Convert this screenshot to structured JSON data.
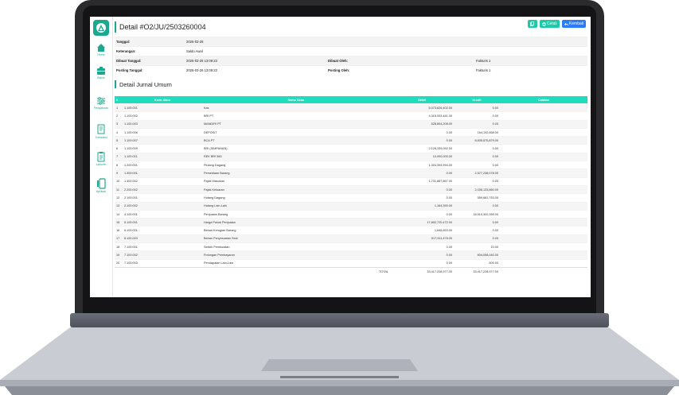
{
  "header": {
    "title": "Detail #O2/JU/2503260004",
    "buttons": {
      "copy": "",
      "print": "Cetak",
      "back": "Kembali"
    }
  },
  "sidebar": {
    "items": [
      {
        "label": "Home",
        "icon": "home-icon"
      },
      {
        "label": "Bisnis",
        "icon": "briefcase-icon"
      },
      {
        "label": "Pengaturan",
        "icon": "sliders-icon"
      },
      {
        "label": "Transaksi",
        "icon": "document-icon"
      },
      {
        "label": "Laporan",
        "icon": "clipboard-icon"
      },
      {
        "label": "Aplikasi",
        "icon": "apps-icon"
      }
    ]
  },
  "info": {
    "tanggal_label": "Tanggal:",
    "tanggal": "2025-03-26",
    "keterangan_label": "Keterangan:",
    "keterangan": "Saldo Awal",
    "dibuat_tanggal_label": "Dibuat Tanggal:",
    "dibuat_tanggal": "2025-03-26 13:09:23",
    "dibuat_oleh_label": "Dibuat Oleh:",
    "dibuat_oleh": "Fakturis 1",
    "posting_tanggal_label": "Posting Tanggal:",
    "posting_tanggal": "2025-03-26 13:09:23",
    "posting_oleh_label": "Posting Oleh:",
    "posting_oleh": "Fakturis 1"
  },
  "section_title": "Detail Jurnal Umum",
  "table": {
    "headers": [
      "#",
      "Kode Akun",
      "Nama Akun",
      "Debit",
      "Kredit",
      "Catatan"
    ],
    "rows": [
      [
        "1",
        "1.100.001",
        "Kas",
        "5,073,626,402.00",
        "0.00",
        ""
      ],
      [
        "2",
        "1.100.002",
        "BRI PT",
        "4,315,333,461.00",
        "0.00",
        ""
      ],
      [
        "3",
        "1.100.003",
        "MANDIRI PT",
        "528,804,208.00",
        "0.00",
        ""
      ],
      [
        "4",
        "1.100.006",
        "DEPOSIT",
        "0.00",
        "164,192,668.00",
        ""
      ],
      [
        "5",
        "1.100.007",
        "BCA PT",
        "0.00",
        "8,835,575,879.00",
        ""
      ],
      [
        "6",
        "1.100.009",
        "BRI (SIMPANAN)",
        "2,128,339,052.00",
        "0.00",
        ""
      ],
      [
        "7",
        "1.100.011",
        "REK BRI 560",
        "10,000,000.00",
        "0.00",
        ""
      ],
      [
        "8",
        "1.200.001",
        "Piutang Dagang",
        "1,304,394,994.00",
        "0.00",
        ""
      ],
      [
        "9",
        "1.300.001",
        "Persediaan Barang",
        "0.00",
        "2,577,238,078.00",
        ""
      ],
      [
        "10",
        "1.400.002",
        "Pajak Masukan",
        "1,731,887,867.00",
        "0.00",
        ""
      ],
      [
        "11",
        "2.200.002",
        "Pajak Keluaran",
        "0.00",
        "2,036,133,660.00",
        ""
      ],
      [
        "12",
        "2.100.001",
        "Hutang Dagang",
        "0.00",
        "559,681,753.00",
        ""
      ],
      [
        "13",
        "2.100.002",
        "Hutang Lain-Lain",
        "1,164,390.00",
        "0.00",
        ""
      ],
      [
        "14",
        "4.100.001",
        "Penjualan Barang",
        "0.00",
        "18,510,300,399.00",
        ""
      ],
      [
        "15",
        "5.100.001",
        "Harga Pokok Penjualan",
        "17,802,720,472.00",
        "0.00",
        ""
      ],
      [
        "16",
        "6.100.001",
        "Beban Kerugian Barang",
        "1,646,653.00",
        "0.00",
        ""
      ],
      [
        "17",
        "6.100.003",
        "Beban Penyesuaian Stok",
        "517,311,478.00",
        "0.00",
        ""
      ],
      [
        "18",
        "7.100.001",
        "Selisih Pembulatan",
        "0.00",
        "10.00",
        ""
      ],
      [
        "19",
        "7.100.002",
        "Potongan Pembayaran",
        "0.00",
        "834,098,040.00",
        ""
      ],
      [
        "20",
        "7.100.003",
        "Pendapatan Lain-Lain",
        "0.00",
        "500.00",
        ""
      ]
    ],
    "total_label": "TOTAL",
    "total_debit": "33,417,228,977.00",
    "total_kredit": "33,417,228,977.00"
  }
}
